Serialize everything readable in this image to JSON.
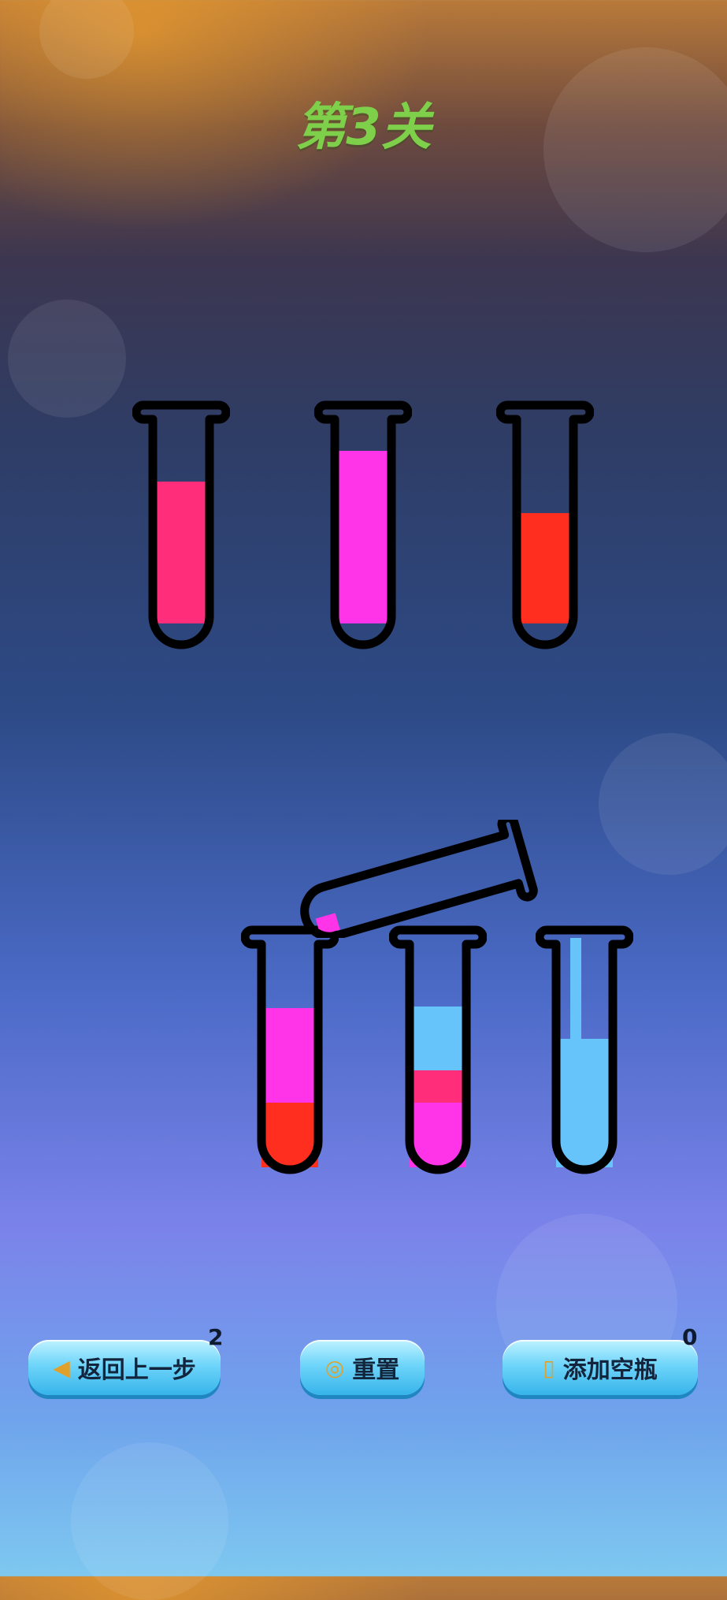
{
  "level_title": "第3关",
  "liquid_colors": {
    "rose": "#ff2d7a",
    "magenta": "#ff33e8",
    "red": "#ff2e1f",
    "sky": "#66c4fb"
  },
  "tubes_top_row": [
    {
      "layers_bottom_to_top": [
        "rose"
      ],
      "fill_fraction": 0.63
    },
    {
      "layers_bottom_to_top": [
        "magenta"
      ],
      "fill_fraction": 0.75
    },
    {
      "layers_bottom_to_top": [
        "red"
      ],
      "fill_fraction": 0.5
    }
  ],
  "tubes_bottom_row": [
    {
      "layers_bottom_to_top": [
        "red",
        "magenta"
      ],
      "layer_fractions": [
        0.26,
        0.38
      ]
    },
    {
      "layers_bottom_to_top": [
        "magenta",
        "rose",
        "sky"
      ],
      "layer_fractions": [
        0.26,
        0.13,
        0.25
      ]
    },
    {
      "layers_bottom_to_top": [
        "sky"
      ],
      "layer_fractions": [
        0.52
      ]
    }
  ],
  "buttons": {
    "undo": {
      "label": "返回上一步",
      "count": "2",
      "icon": "undo-arrow-icon"
    },
    "reset": {
      "label": "重置",
      "icon": "reset-ring-icon"
    },
    "add_bottle": {
      "label": "添加空瓶",
      "count": "0",
      "icon": "add-bottle-icon"
    }
  }
}
